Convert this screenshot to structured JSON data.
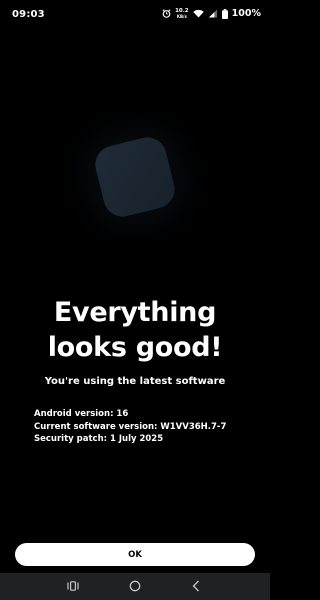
{
  "status_bar": {
    "time": "09:03",
    "net_speed_value": "10.2",
    "net_speed_unit": "KB/s",
    "battery_percent": "100%",
    "icons": [
      "alarm-icon",
      "wifi-icon",
      "signal-icon",
      "battery-icon"
    ]
  },
  "main": {
    "headline_line1": "Everything",
    "headline_line2": "looks good!",
    "subtitle": "You're using the latest software",
    "details": {
      "android_version": "Android version: 16",
      "software_version": "Current software version: W1VV36H.7-7",
      "security_patch": "Security patch: 1 July 2025"
    },
    "ok_label": "OK"
  },
  "navigation_bar": {
    "icons": [
      "recents-icon",
      "home-icon",
      "back-icon"
    ]
  }
}
